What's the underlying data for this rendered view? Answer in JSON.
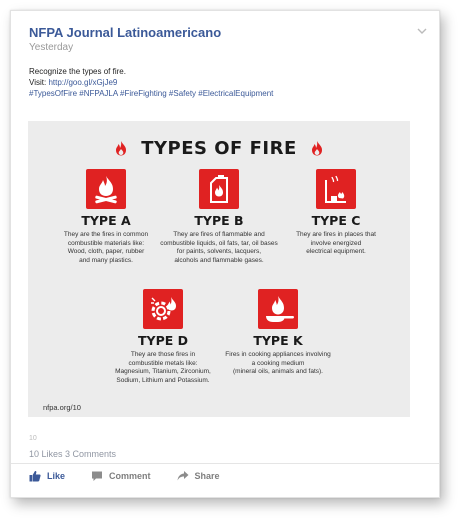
{
  "post": {
    "page_name": "NFPA Journal Latinoamericano",
    "timestamp": "Yesterday",
    "line1": "Recognize the types of fire.",
    "visit_label": "Visit:",
    "link": "http://goo.gl/xGjJe9",
    "hashtags": "#TypesOfFire #NFPAJLA #FireFighting #Safety #ElectricalEquipment"
  },
  "infographic": {
    "title": "TYPES OF FIRE",
    "source": "nfpa.org/10",
    "accent_color": "#e02222",
    "types": [
      {
        "name": "TYPE A",
        "icon": "campfire-icon",
        "desc": "They are the fires in common\ncombustible materials like:\nWood, cloth, paper, rubber\nand many plastics."
      },
      {
        "name": "TYPE B",
        "icon": "fuel-can-icon",
        "desc": "They are fires of flammable and\ncombustible liquids, oil fats, tar, oil bases\nfor paints, solvents, lacquers,\nalcohols and flammable gases."
      },
      {
        "name": "TYPE C",
        "icon": "electrical-outlet-fire-icon",
        "desc": "They are fires in places that\ninvolve energized\nelectrical equipment."
      },
      {
        "name": "TYPE D",
        "icon": "gear-fire-icon",
        "desc": "They are those fires in\ncombustible metals like:\nMagnesium, Titanium, Zirconium,\nSodium, Lithium and Potassium."
      },
      {
        "name": "TYPE K",
        "icon": "frying-pan-fire-icon",
        "desc": "Fires in cooking appliances involving\na cooking medium\n(mineral oils, animals and fats)."
      }
    ]
  },
  "engagement": {
    "tick": "10",
    "stats": "10 Likes 3 Comments"
  },
  "actions": {
    "like": "Like",
    "comment": "Comment",
    "share": "Share"
  }
}
